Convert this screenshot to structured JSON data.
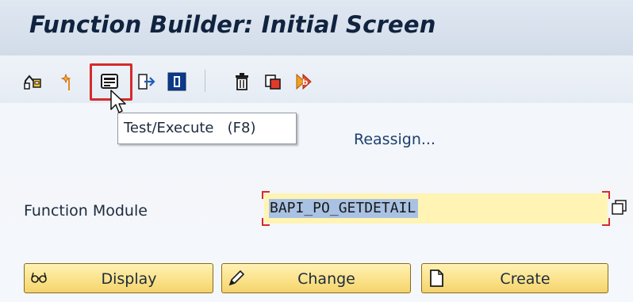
{
  "window": {
    "title": "Function Builder: Initial Screen"
  },
  "toolbar": {
    "items": [
      {
        "icon": "other-object-icon"
      },
      {
        "icon": "new-object-icon"
      },
      {
        "icon": "test-execute-icon",
        "highlighted": true
      },
      {
        "icon": "where-used-icon"
      },
      {
        "icon": "info-icon"
      },
      {
        "icon": "delete-icon"
      },
      {
        "icon": "copy-icon"
      },
      {
        "icon": "rename-icon"
      }
    ],
    "reassign_label": "Reassign..."
  },
  "tooltip": {
    "text": "Test/Execute   (F8)"
  },
  "form": {
    "function_module_label": "Function Module",
    "function_module_value": "BAPI_PO_GETDETAIL"
  },
  "buttons": {
    "display": "Display",
    "change": "Change",
    "create": "Create"
  },
  "colors": {
    "highlight": "#d42b2b",
    "field_bg": "#fff4b3",
    "button_bg": "#fbe28a"
  }
}
